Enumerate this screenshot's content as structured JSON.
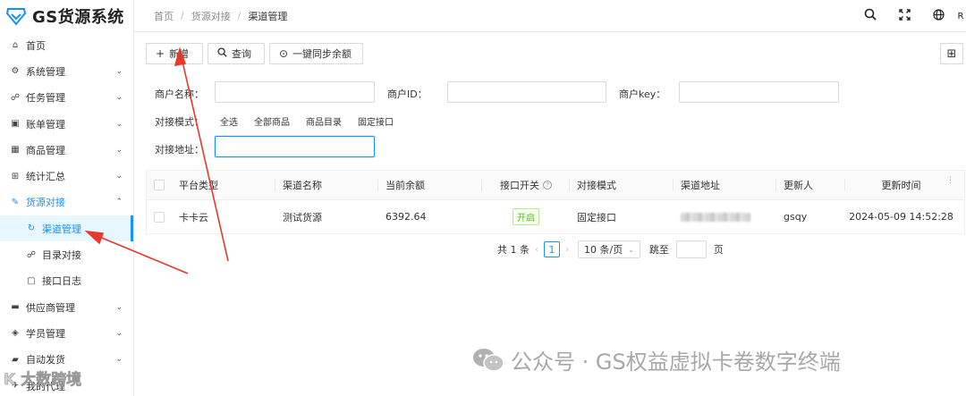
{
  "app": {
    "title": "GS货源系统"
  },
  "breadcrumb": [
    "首页",
    "货源对接",
    "渠道管理"
  ],
  "header_icons": [
    "search-icon",
    "fullscreen-icon",
    "globe-icon",
    "R"
  ],
  "sidebar": {
    "items": [
      {
        "label": "首页",
        "icon": "home-icon"
      },
      {
        "label": "系统管理",
        "icon": "settings-icon"
      },
      {
        "label": "任务管理",
        "icon": "task-icon"
      },
      {
        "label": "账单管理",
        "icon": "bill-icon"
      },
      {
        "label": "商品管理",
        "icon": "calendar-icon"
      },
      {
        "label": "统计汇总",
        "icon": "grid-icon"
      },
      {
        "label": "货源对接",
        "icon": "plug-icon"
      },
      {
        "label": "渠道管理",
        "icon": "channel-icon"
      },
      {
        "label": "目录对接",
        "icon": "catalog-icon"
      },
      {
        "label": "接口日志",
        "icon": "log-icon"
      },
      {
        "label": "供应商管理",
        "icon": "supplier-icon"
      },
      {
        "label": "学员管理",
        "icon": "student-icon"
      },
      {
        "label": "自动发货",
        "icon": "truck-icon"
      },
      {
        "label": "我的代理",
        "icon": "agent-icon"
      }
    ]
  },
  "toolbar": {
    "add_label": "新增",
    "query_label": "查询",
    "sync_label": "一键同步余额"
  },
  "search": {
    "merchant_name_label": "商户名称：",
    "merchant_id_label": "商户ID：",
    "merchant_key_label": "商户key：",
    "mode_label": "对接模式：",
    "mode_options": [
      "全选",
      "全部商品",
      "商品目录",
      "固定接口"
    ],
    "address_label": "对接地址："
  },
  "table": {
    "columns": [
      "平台类型",
      "渠道名称",
      "当前余额",
      "接口开关",
      "对接模式",
      "渠道地址",
      "更新人",
      "更新时间"
    ],
    "rows": [
      {
        "platform": "卡卡云",
        "name": "测试货源",
        "balance": "6392.64",
        "switch": "开启",
        "mode": "固定接口",
        "address": "",
        "updater": "gsqy",
        "time": "2024-05-09 14:52:28"
      }
    ]
  },
  "pagination": {
    "total_text": "共 1 条",
    "current_page": "1",
    "page_size": "10 条/页",
    "jump_label": "跳至",
    "page_label": "页"
  },
  "watermark": {
    "right": "公众号 · GS权益虚拟卡卷数字终端",
    "left": "K 大数跨境"
  },
  "colors": {
    "primary": "#1890ff",
    "success": "#52c41a",
    "annotation": "#e8382b"
  }
}
